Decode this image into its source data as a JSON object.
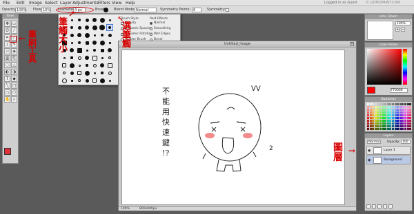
{
  "menu": {
    "items": [
      "File",
      "Edit",
      "Image",
      "Select",
      "Layer",
      "Adjustments",
      "Filters",
      "View",
      "Help"
    ],
    "right_text": "Logged in as Guest",
    "watermark": "© GOMOPAINT.COM"
  },
  "options_bar": {
    "opacity_label": "Opacity:",
    "opacity_value": "100%",
    "flow_label": "Flow:",
    "flow_value": "10%",
    "diameter_label": "Diameter:",
    "diameter_value": "4 px",
    "brush_label": "Brush:",
    "blend_label": "Blend Mode:",
    "blend_value": "Normal",
    "symmetry_points_label": "Symmetry Points:",
    "symmetry_points_value": "6",
    "symmetry_label": "Symmetry:"
  },
  "tools_panel": {
    "title": "Tools",
    "tool_icons": [
      "move-icon",
      "marquee-icon",
      "lasso-icon",
      "wand-icon",
      "crop-icon",
      "eyedropper-icon",
      "brush-icon",
      "pencil-icon",
      "eraser-icon",
      "fill-icon",
      "gradient-icon",
      "clone-icon",
      "blur-icon",
      "sharpen-icon",
      "dodge-icon",
      "burn-icon",
      "text-icon",
      "shape-icon",
      "line-icon",
      "rect-icon",
      "ellipse-icon",
      "polygon-icon",
      "hand-icon",
      "zoom-icon"
    ],
    "primary_color": "#e0303a",
    "secondary_color": "#ffffff"
  },
  "brush_popup": {
    "style_title": "Brush Style",
    "style_options": [
      "Gravity",
      "Dynamic Spacing",
      "Dynamic Rotation",
      "Scatter Brush",
      "Outline"
    ],
    "effects_title": "Post Effects",
    "effect_options": [
      "Normal",
      "Smoothing",
      "Wet Edges",
      "Bevel"
    ],
    "selected_effect": "Normal",
    "slider_values": [
      "10",
      "10",
      "60",
      "60"
    ],
    "slider_levels": [
      0.3,
      0.3,
      0.6,
      0.6
    ]
  },
  "document": {
    "title": "Untitled_Image",
    "zoom": "100%",
    "size": "800x600px"
  },
  "drawing": {
    "vertical_text": [
      "不",
      "能",
      "用",
      "快",
      "速",
      "鍵",
      "!?"
    ],
    "mark_text": "ᐯᐯ",
    "number_text": "2"
  },
  "info_panel": {
    "title": "Info / Zoom",
    "zoom_value": "100%"
  },
  "color_picker": {
    "title": "Color Picker",
    "hex_value": "FF0000"
  },
  "swatches": {
    "title": "Swatches"
  },
  "layers": {
    "title": "Layers",
    "blend_value": "Normal",
    "opacity_label": "Opacity:",
    "opacity_value": "100",
    "items": [
      {
        "name": "Layer 1",
        "active": false
      },
      {
        "name": "Background",
        "active": true
      }
    ]
  },
  "annotations": {
    "brush_size": [
      "筆",
      "觸",
      "大",
      "小"
    ],
    "select_brush": [
      "選",
      "筆",
      "觸"
    ],
    "brush_tool": [
      "筆",
      "刷",
      "工",
      "具"
    ],
    "layers": [
      "圖",
      "層"
    ]
  },
  "colors": {
    "annotation_red": "#d80000",
    "brush_cell_selected": "#cfe0ff",
    "layer_selected": "#b9c9e6"
  }
}
